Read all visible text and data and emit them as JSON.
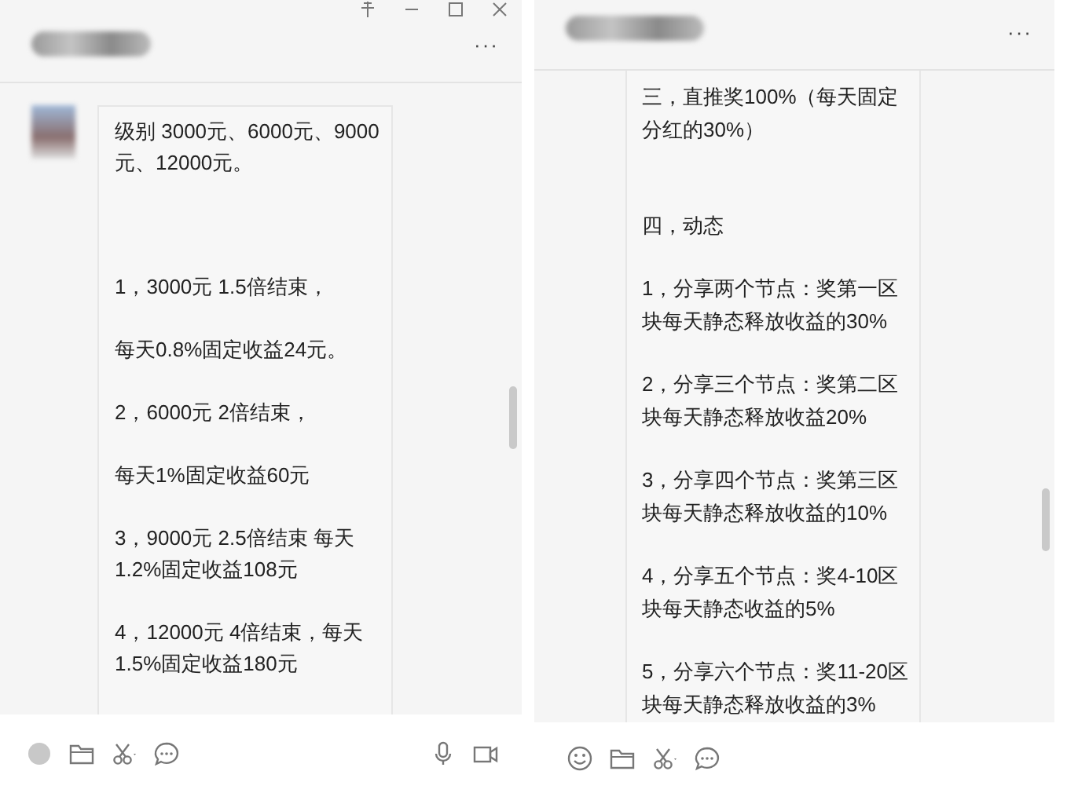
{
  "windows": [
    {
      "window_controls": [
        {
          "kind": "pin"
        },
        {
          "kind": "minimize"
        },
        {
          "kind": "maximize"
        },
        {
          "kind": "close"
        }
      ],
      "more_button": "···",
      "avatar": true,
      "messages": [
        {
          "paragraphs": [
            "级别 3000元、6000元、9000元、12000元。",
            "1，3000元  1.5倍结束，",
            "每天0.8%固定收益24元。",
            "2，6000元  2倍结束，",
            "每天1%固定收益60元",
            "3，9000元   2.5倍结束 每天1.2%固定收益108元",
            "4，12000元  4倍结束，每天1.5%固定收益180元"
          ]
        }
      ],
      "toolbar": [
        {
          "kind": "sticker"
        },
        {
          "kind": "folder"
        },
        {
          "kind": "scissors"
        },
        {
          "kind": "chat"
        }
      ],
      "toolbar_right": [
        {
          "kind": "mic"
        },
        {
          "kind": "video"
        }
      ]
    },
    {
      "more_button": "···",
      "messages": [
        {
          "paragraphs": [
            "三，直推奖100%（每天固定分红的30%）",
            "四，动态",
            "1，分享两个节点：奖第一区块每天静态释放收益的30%",
            "2，分享三个节点：奖第二区块每天静态释放收益20%",
            "3，分享四个节点：奖第三区块每天静态释放收益的10%",
            "4，分享五个节点：奖4-10区块每天静态收益的5%",
            "5，分享六个节点：奖11-20区块每天静态释放收益的3%"
          ]
        }
      ],
      "toolbar": [
        {
          "kind": "emoji"
        },
        {
          "kind": "folder"
        },
        {
          "kind": "scissors"
        },
        {
          "kind": "chat"
        }
      ]
    }
  ]
}
